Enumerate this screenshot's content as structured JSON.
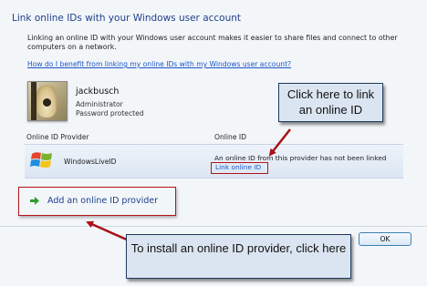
{
  "dialog": {
    "title": "Link online IDs with your Windows user account",
    "intro": "Linking an online ID with your Windows user account makes it easier to share files and connect to other computers on a network.",
    "help_link": "How do I benefit from linking my online IDs with my Windows user account?"
  },
  "user": {
    "name": "jackbusch",
    "role": "Administrator",
    "password_status": "Password protected"
  },
  "table": {
    "columns": [
      "Online ID Provider",
      "Online ID"
    ],
    "rows": [
      {
        "provider": "WindowsLiveID",
        "status": "An online ID from this provider has not been linked",
        "action": "Link online ID"
      }
    ]
  },
  "add_provider": {
    "label": "Add an online ID provider"
  },
  "buttons": {
    "ok": "OK"
  },
  "annotations": {
    "callout_link": "Click here to link an online ID",
    "callout_install": "To install an online ID provider, click here"
  },
  "colors": {
    "title": "#1f3f8c",
    "link": "#1a56c8",
    "highlight_box": "#b4141b",
    "callout_bg": "#dbe5f1",
    "arrow": "#a81218"
  },
  "icons": {
    "user_picture": "guitar-avatar",
    "provider_logo": "windows-logo-icon",
    "add_arrow": "green-arrow-icon"
  }
}
